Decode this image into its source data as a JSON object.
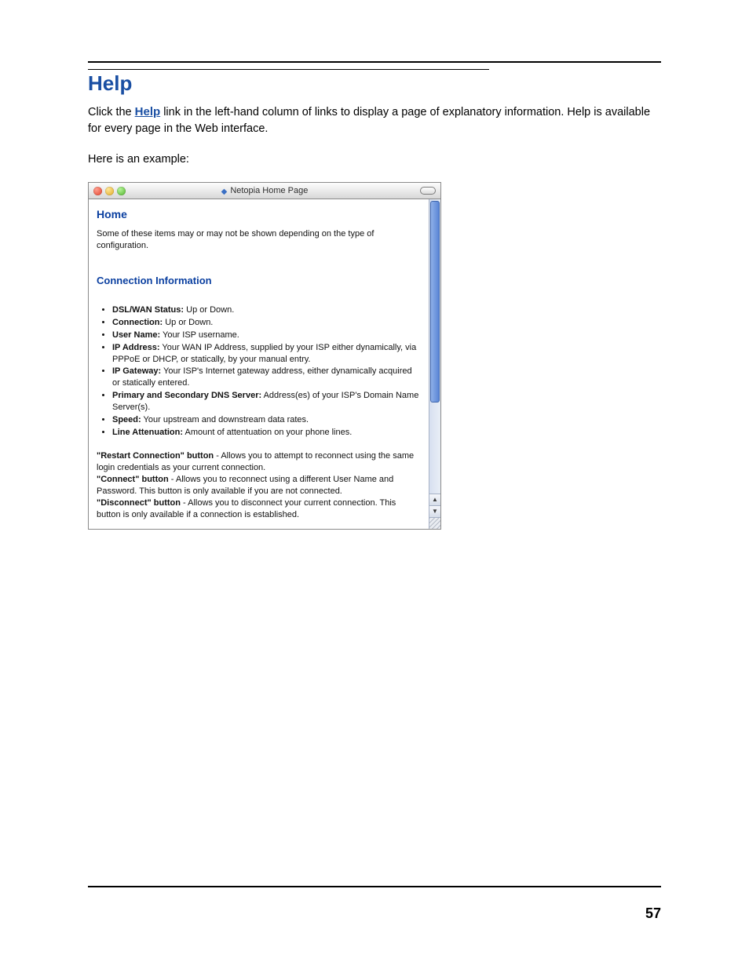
{
  "page": {
    "title": "Help",
    "intro_before_link": "Click the ",
    "link_label": "Help",
    "intro_after_link": " link in the left-hand column of links to display a page of explanatory information. Help is available for every page in the Web interface.",
    "example_lead": "Here is an example:",
    "page_number": "57"
  },
  "window": {
    "title": "Netopia Home Page",
    "home_heading": "Home",
    "home_intro": "Some of these items may or may not be shown depending on the type of configuration.",
    "conn_heading": "Connection Information",
    "items": [
      {
        "label": "DSL/WAN Status:",
        "desc": " Up or Down."
      },
      {
        "label": "Connection:",
        "desc": " Up or Down."
      },
      {
        "label": "User Name:",
        "desc": " Your ISP username."
      },
      {
        "label": "IP Address:",
        "desc": " Your WAN IP Address, supplied by your ISP either dynamically, via PPPoE or DHCP, or statically, by your manual entry."
      },
      {
        "label": "IP Gateway:",
        "desc": " Your ISP's Internet gateway address, either dynamically acquired or statically entered."
      },
      {
        "label": "Primary and Secondary DNS Server:",
        "desc": " Address(es) of your ISP's Domain Name Server(s)."
      },
      {
        "label": "Speed:",
        "desc": " Your upstream and downstream data rates."
      },
      {
        "label": "Line Attenuation:",
        "desc": " Amount of attentuation on your phone lines."
      }
    ],
    "buttons_para": {
      "p1_label": "\"Restart Connection\" button",
      "p1_desc": " - Allows you to attempt to reconnect using the same login credentials as your current connection.",
      "p2_label": "\"Connect\" button",
      "p2_desc": " - Allows you to reconnect using a different User Name and Password. This button is only available if you are not connected.",
      "p3_label": "\"Disconnect\" button",
      "p3_desc": " - Allows you to disconnect your current connection. This button is only available if a connection is established."
    }
  }
}
